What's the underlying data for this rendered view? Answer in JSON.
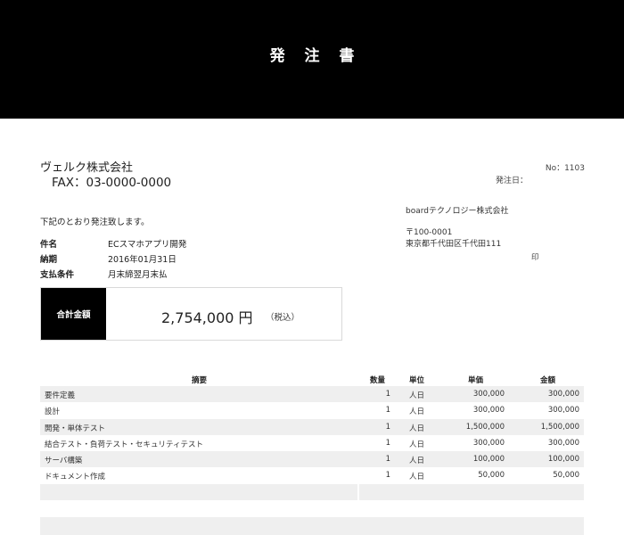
{
  "document": {
    "title": "発 注 書",
    "number": "No：1103",
    "issue_date_label": "発注日："
  },
  "recipient": {
    "name": "ヴェルク株式会社",
    "fax": "FAX：03-0000-0000"
  },
  "intro": "下記のとおり発注致します。",
  "info": {
    "subject_label": "件名",
    "subject_value": "ECスマホアプリ開発",
    "deadline_label": "納期",
    "deadline_value": "2016年01月31日",
    "payment_label": "支払条件",
    "payment_value": "月末締翌月末払"
  },
  "issuer": {
    "company": "boardテクノロジー株式会社",
    "postal": "〒100-0001",
    "address": "東京都千代田区千代田111",
    "seal": "印"
  },
  "total": {
    "label": "合計金額",
    "amount": "2,754,000 円",
    "tax_note": "（税込）"
  },
  "table": {
    "headers": {
      "description": "摘要",
      "quantity": "数量",
      "unit": "単位",
      "unit_price": "単価",
      "amount": "金額"
    },
    "rows": [
      {
        "description": "要件定義",
        "quantity": "1",
        "unit": "人日",
        "unit_price": "300,000",
        "amount": "300,000"
      },
      {
        "description": "設計",
        "quantity": "1",
        "unit": "人日",
        "unit_price": "300,000",
        "amount": "300,000"
      },
      {
        "description": "開発・単体テスト",
        "quantity": "1",
        "unit": "人日",
        "unit_price": "1,500,000",
        "amount": "1,500,000"
      },
      {
        "description": "結合テスト・負荷テスト・セキュリティテスト",
        "quantity": "1",
        "unit": "人日",
        "unit_price": "300,000",
        "amount": "300,000"
      },
      {
        "description": "サーバ構築",
        "quantity": "1",
        "unit": "人日",
        "unit_price": "100,000",
        "amount": "100,000"
      },
      {
        "description": "ドキュメント作成",
        "quantity": "1",
        "unit": "人日",
        "unit_price": "50,000",
        "amount": "50,000"
      }
    ]
  }
}
